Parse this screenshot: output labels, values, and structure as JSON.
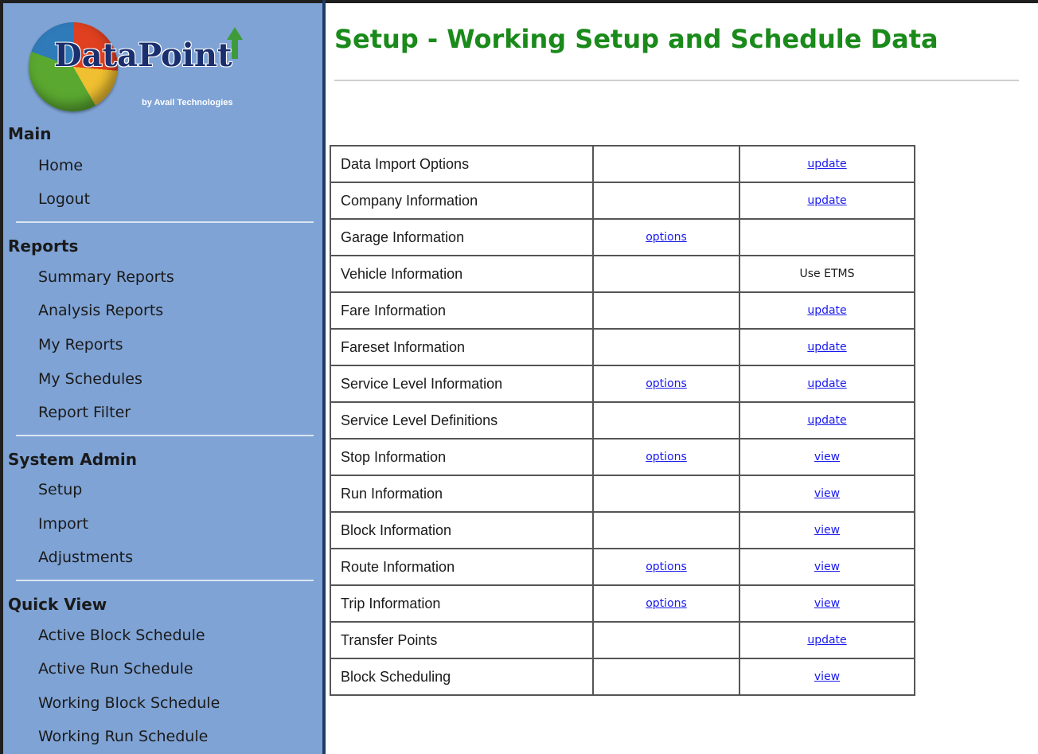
{
  "logo": {
    "name": "DataPoint",
    "tagline": "by Avail Technologies"
  },
  "sidebar": {
    "sections": [
      {
        "heading": "Main",
        "items": [
          "Home",
          "Logout"
        ]
      },
      {
        "heading": "Reports",
        "items": [
          "Summary Reports",
          "Analysis Reports",
          "My Reports",
          "My Schedules",
          "Report Filter"
        ]
      },
      {
        "heading": "System Admin",
        "items": [
          "Setup",
          "Import",
          "Adjustments"
        ]
      },
      {
        "heading": "Quick View",
        "items": [
          "Active Block Schedule",
          "Active Run Schedule",
          "Working Block Schedule",
          "Working Run Schedule"
        ]
      }
    ]
  },
  "main": {
    "title": "Setup - Working Setup and Schedule Data",
    "rows": [
      {
        "name": "Data Import Options",
        "mid": "",
        "action": "update"
      },
      {
        "name": "Company Information",
        "mid": "",
        "action": "update"
      },
      {
        "name": "Garage Information",
        "mid": "options",
        "action": ""
      },
      {
        "name": "Vehicle Information",
        "mid": "",
        "action": "Use ETMS",
        "action_plain": true
      },
      {
        "name": "Fare Information",
        "mid": "",
        "action": "update"
      },
      {
        "name": "Fareset Information",
        "mid": "",
        "action": "update"
      },
      {
        "name": "Service Level Information",
        "mid": "options",
        "action": "update"
      },
      {
        "name": "Service Level Definitions",
        "mid": "",
        "action": "update"
      },
      {
        "name": "Stop Information",
        "mid": "options",
        "action": "view"
      },
      {
        "name": "Run Information",
        "mid": "",
        "action": "view"
      },
      {
        "name": "Block Information",
        "mid": "",
        "action": "view"
      },
      {
        "name": "Route Information",
        "mid": "options",
        "action": "view"
      },
      {
        "name": "Trip Information",
        "mid": "options",
        "action": "view"
      },
      {
        "name": "Transfer Points",
        "mid": "",
        "action": "update"
      },
      {
        "name": "Block Scheduling",
        "mid": "",
        "action": "view"
      }
    ]
  },
  "colors": {
    "sidebar_bg": "#7fa3d5",
    "title_green": "#1a8a1a",
    "link_blue": "#1a1aee"
  }
}
